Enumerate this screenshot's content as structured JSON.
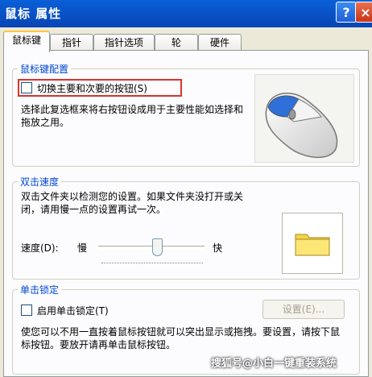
{
  "window": {
    "title": "鼠标 属性",
    "help": "?",
    "close": "×"
  },
  "tabs": [
    "鼠标键",
    "指针",
    "指针选项",
    "轮",
    "硬件"
  ],
  "button_config": {
    "title": "鼠标键配置",
    "switch_label": "切换主要和次要的按钮(S)",
    "description": "选择此复选框来将右按钮设成用于主要性能如选择和拖放之用。"
  },
  "double_click": {
    "title": "双击速度",
    "description": "双击文件夹以检测您的设置。如果文件夹没打开或关闭，请用慢一点的设置再试一次。",
    "speed_label": "速度(D):",
    "slow": "慢",
    "fast": "快",
    "speed_value": 0.55
  },
  "click_lock": {
    "title": "单击锁定",
    "enable_label": "启用单击锁定(T)",
    "settings_button": "设置(E)...",
    "description": "使您可以不用一直按着鼠标按钮就可以突出显示或拖拽。要设置，请按下鼠标按钮。要放开请再单击鼠标按钮。"
  },
  "watermark": "搜狐号@小白一键重装系统"
}
